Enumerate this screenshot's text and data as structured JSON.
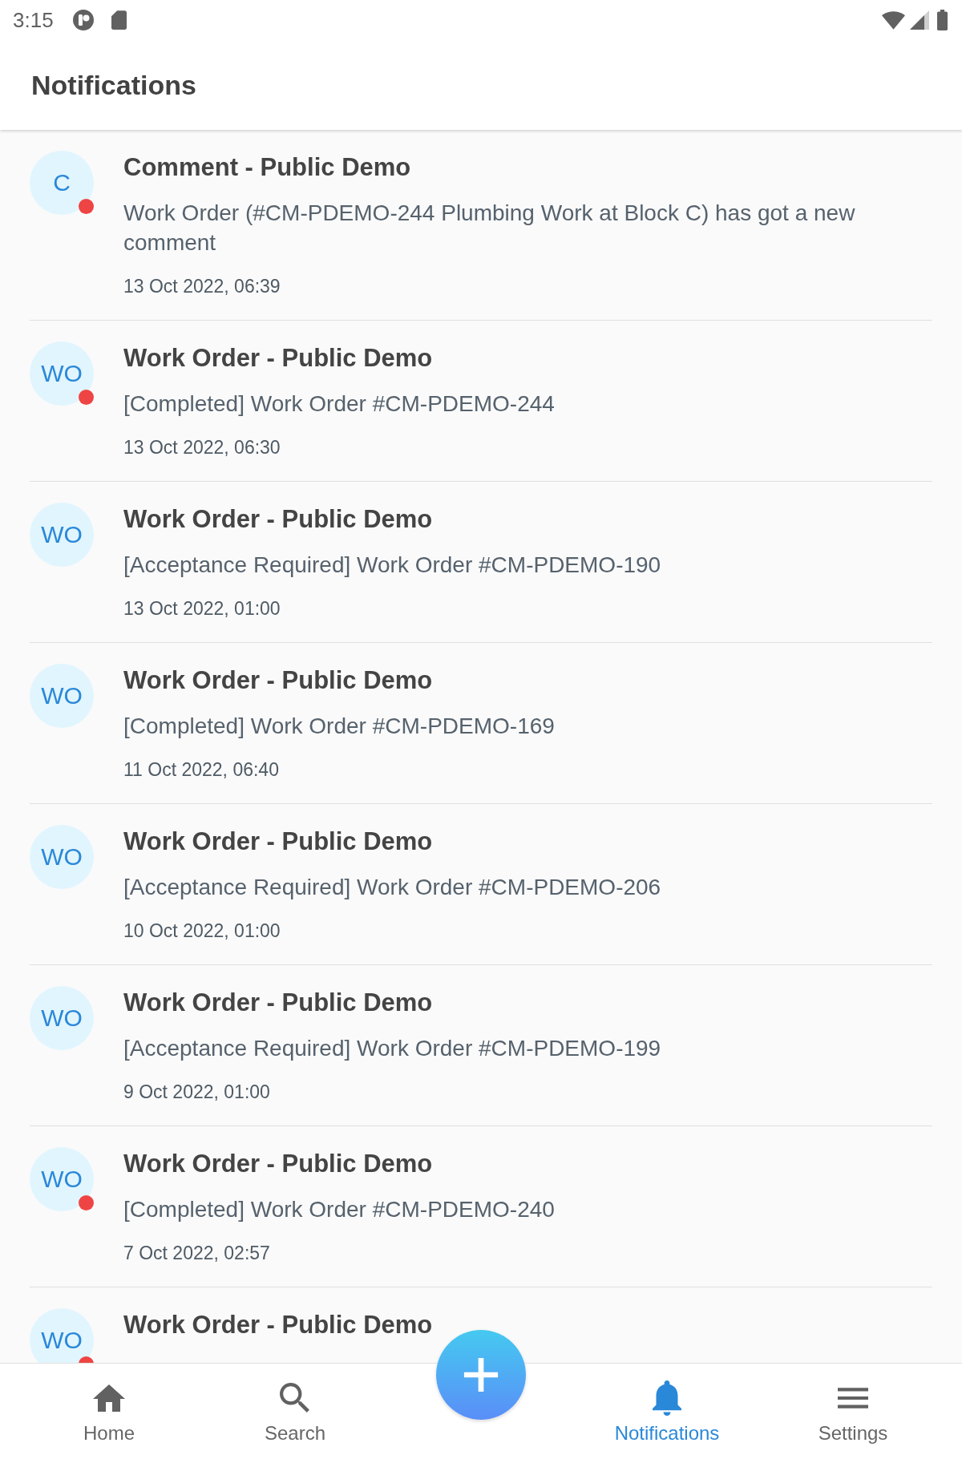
{
  "status_bar": {
    "time": "3:15"
  },
  "app_bar": {
    "title": "Notifications"
  },
  "notifications": [
    {
      "initials": "C",
      "title": "Comment - Public Demo",
      "body": "Work Order (#CM-PDEMO-244 Plumbing Work at Block C) has got a new comment",
      "date": "13 Oct 2022, 06:39",
      "unread": true
    },
    {
      "initials": "WO",
      "title": "Work Order - Public Demo",
      "body": "[Completed] Work Order #CM-PDEMO-244",
      "date": "13 Oct 2022, 06:30",
      "unread": true
    },
    {
      "initials": "WO",
      "title": "Work Order - Public Demo",
      "body": "[Acceptance Required] Work Order #CM-PDEMO-190",
      "date": "13 Oct 2022, 01:00",
      "unread": false
    },
    {
      "initials": "WO",
      "title": "Work Order - Public Demo",
      "body": "[Completed] Work Order #CM-PDEMO-169",
      "date": "11 Oct 2022, 06:40",
      "unread": false
    },
    {
      "initials": "WO",
      "title": "Work Order - Public Demo",
      "body": "[Acceptance Required] Work Order #CM-PDEMO-206",
      "date": "10 Oct 2022, 01:00",
      "unread": false
    },
    {
      "initials": "WO",
      "title": "Work Order - Public Demo",
      "body": "[Acceptance Required] Work Order #CM-PDEMO-199",
      "date": "9 Oct 2022, 01:00",
      "unread": false
    },
    {
      "initials": "WO",
      "title": "Work Order - Public Demo",
      "body": "[Completed] Work Order #CM-PDEMO-240",
      "date": "7 Oct 2022, 02:57",
      "unread": true
    },
    {
      "initials": "WO",
      "title": "Work Order - Public Demo",
      "unread": true
    }
  ],
  "bottom_nav": {
    "items": [
      {
        "label": "Home",
        "selected": false
      },
      {
        "label": "Search",
        "selected": false
      },
      {
        "label": "Notifications",
        "selected": true
      },
      {
        "label": "Settings",
        "selected": false
      }
    ]
  }
}
